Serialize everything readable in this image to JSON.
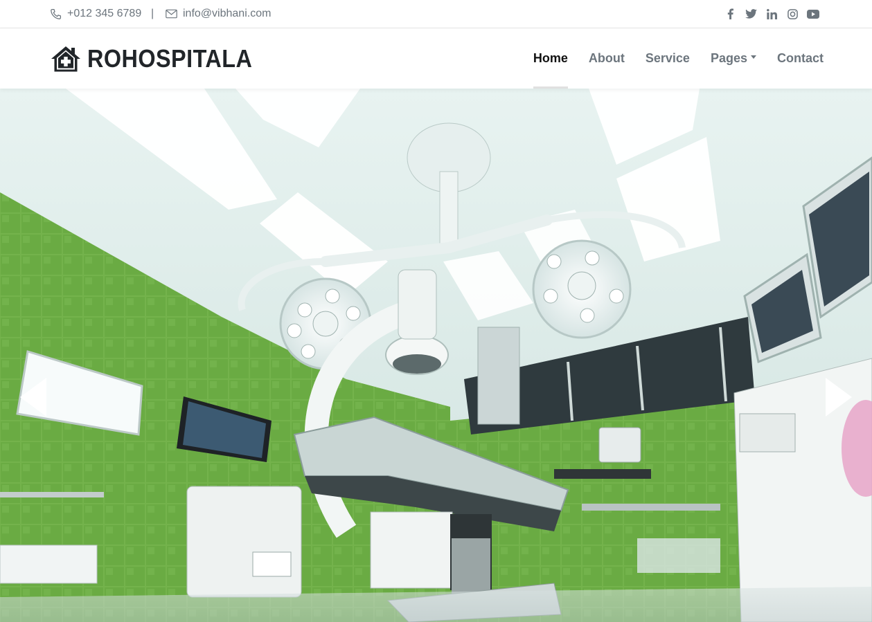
{
  "topbar": {
    "phone": "+012 345 6789",
    "separator": "|",
    "email": "info@vibhani.com",
    "socials": [
      {
        "name": "facebook-icon"
      },
      {
        "name": "twitter-icon"
      },
      {
        "name": "linkedin-icon"
      },
      {
        "name": "instagram-icon"
      },
      {
        "name": "youtube-icon"
      }
    ]
  },
  "navbar": {
    "brand": "ROHOSPITALA",
    "items": [
      {
        "label": "Home",
        "active": true
      },
      {
        "label": "About"
      },
      {
        "label": "Service"
      },
      {
        "label": "Pages",
        "dropdown": true
      },
      {
        "label": "Contact"
      }
    ]
  },
  "hero": {
    "image": "operating-room-photo",
    "prev_icon": "chevron-left-icon",
    "next_icon": "chevron-right-icon"
  },
  "colors": {
    "text_dark": "#212529",
    "text_muted": "#6c757d",
    "tile_green": "#6fb04a"
  }
}
